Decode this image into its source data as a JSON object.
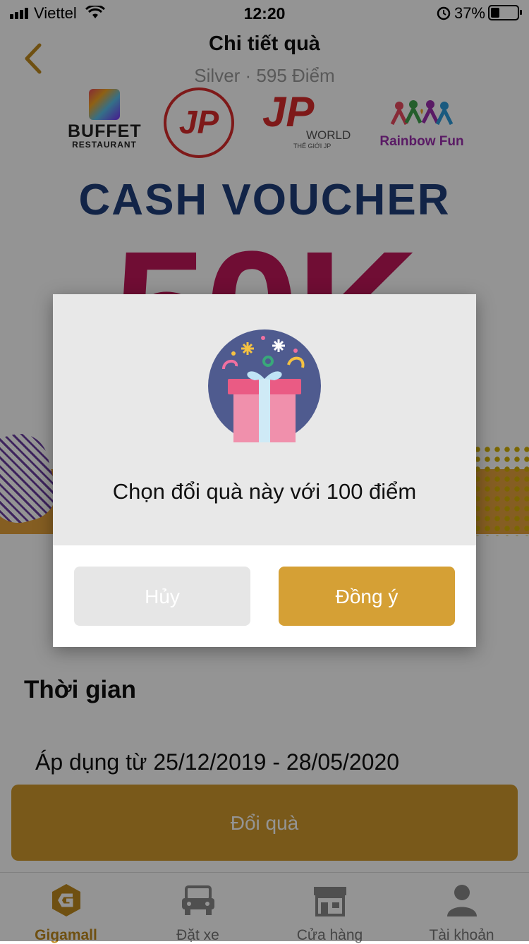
{
  "status_bar": {
    "carrier": "Viettel",
    "time": "12:20",
    "battery": "37%"
  },
  "header": {
    "title": "Chi tiết quà",
    "subtitle": "Silver  ·  595 Điểm"
  },
  "banner": {
    "logos": {
      "buffet_line1": "BUFFET",
      "buffet_line2": "RESTAURANT",
      "jazzy": "JP",
      "jpworld": "JP",
      "jpworld_word": "WORLD",
      "jpworld_small": "THẾ GIỚI JP",
      "rainbow": "Rainbow Fun"
    },
    "headline": "CASH VOUCHER",
    "amount": "50K"
  },
  "details": {
    "section_title": "Thời gian",
    "dates": "Áp dụng từ 25/12/2019 - 28/05/2020"
  },
  "redeem_button": "Đổi quà",
  "tabbar": [
    {
      "label": "Gigamall",
      "icon": "gigamall-logo-icon",
      "active": true
    },
    {
      "label": "Đặt xe",
      "icon": "car-icon",
      "active": false
    },
    {
      "label": "Cửa hàng",
      "icon": "store-icon",
      "active": false
    },
    {
      "label": "Tài khoản",
      "icon": "user-icon",
      "active": false
    }
  ],
  "dialog": {
    "icon": "gift-icon",
    "message": "Chọn đổi quà này với 100 điểm",
    "cancel": "Hủy",
    "confirm": "Đồng ý"
  },
  "colors": {
    "accent": "#d09a2e",
    "tab_active": "#c08a1e",
    "overlay": "rgba(0,0,0,0.42)"
  }
}
